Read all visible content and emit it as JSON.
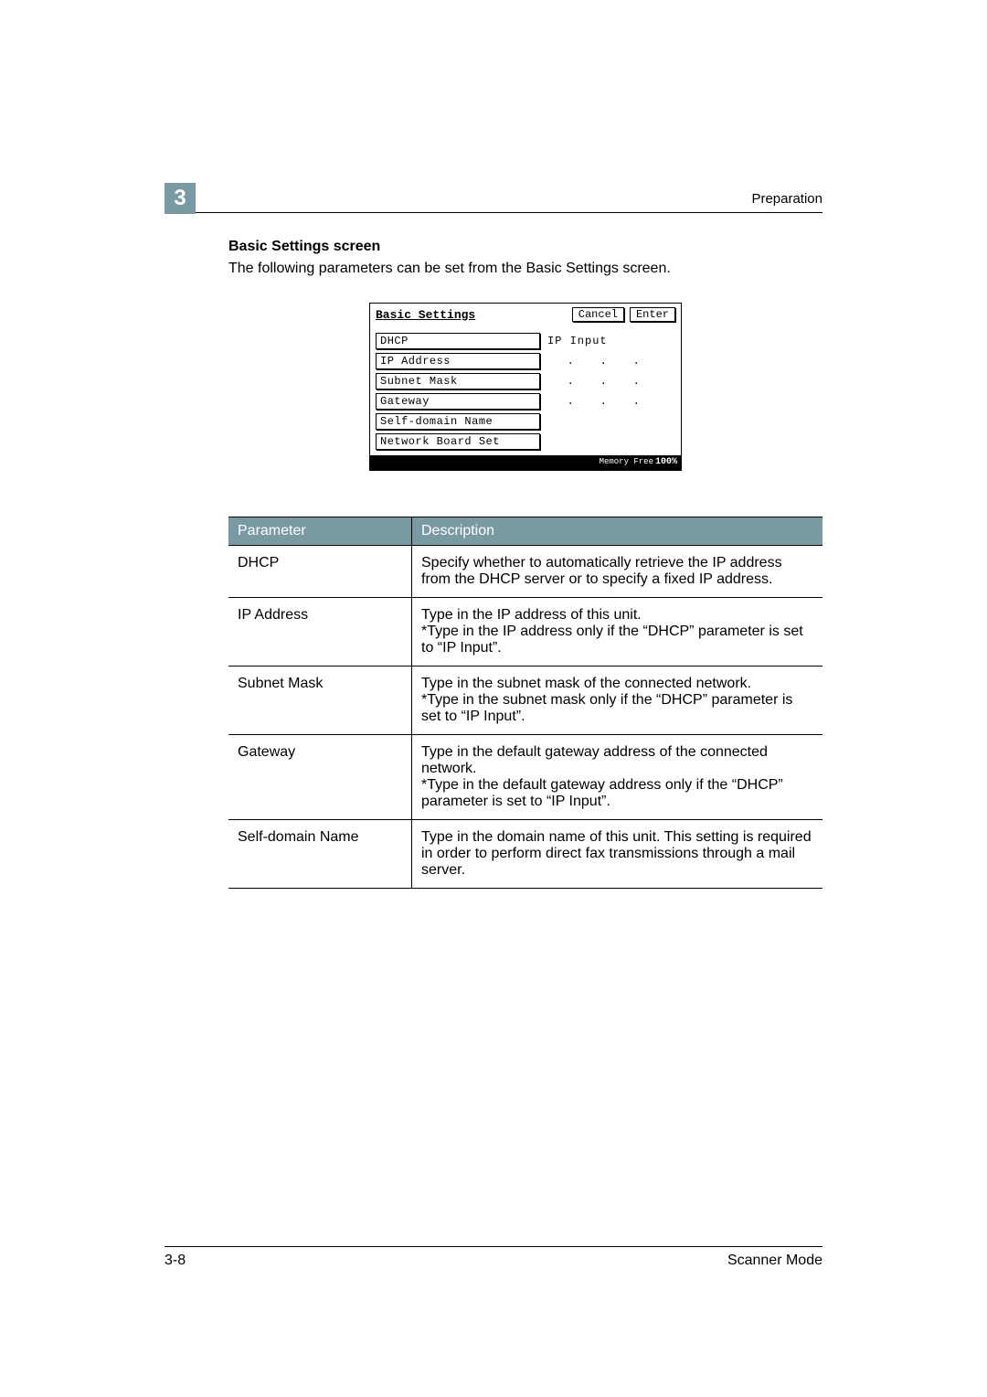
{
  "header": {
    "chapter_number": "3",
    "chapter_title": "Preparation"
  },
  "subhead": "Basic Settings screen",
  "intro_para": "The following parameters can be set from the Basic Settings screen.",
  "device_screen": {
    "title": "Basic Settings",
    "cancel_label": "Cancel",
    "enter_label": "Enter",
    "rows": [
      {
        "label": "DHCP",
        "value": "IP Input",
        "dots": false
      },
      {
        "label": "IP Address",
        "value": "",
        "dots": true
      },
      {
        "label": "Subnet Mask",
        "value": "",
        "dots": true
      },
      {
        "label": "Gateway",
        "value": "",
        "dots": true
      },
      {
        "label": "Self-domain Name",
        "value": "",
        "dots": false
      },
      {
        "label": "Network Board Set",
        "value": "",
        "dots": false
      }
    ],
    "memory_label": "Memory\nFree",
    "memory_pct": "100%"
  },
  "param_table": {
    "head_param": "Parameter",
    "head_desc": "Description",
    "rows": [
      {
        "param": "DHCP",
        "desc": "Specify whether to automatically retrieve the IP address from the DHCP server or to specify a fixed IP address."
      },
      {
        "param": "IP Address",
        "desc": "Type in the IP address of this unit.\n*Type in the IP address only if the “DHCP” parameter is set to “IP Input”."
      },
      {
        "param": "Subnet Mask",
        "desc": "Type in the subnet mask of the connected network.\n*Type in the subnet mask only if the “DHCP” parameter is set to “IP Input”."
      },
      {
        "param": "Gateway",
        "desc": "Type in the default gateway address of the connected network.\n*Type in the default gateway address only if the “DHCP” parameter is set to “IP Input”."
      },
      {
        "param": "Self-domain Name",
        "desc": "Type in the domain name of this unit. This setting is required in order to perform direct fax transmissions through a mail server."
      }
    ]
  },
  "footer": {
    "page_num": "3-8",
    "doc_title": "Scanner Mode"
  }
}
